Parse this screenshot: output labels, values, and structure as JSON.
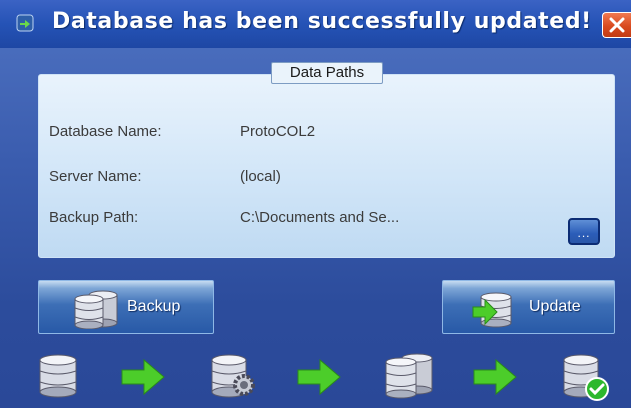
{
  "window": {
    "title": "Database has been successfully updated!"
  },
  "panel": {
    "title": "Data Paths",
    "fields": [
      {
        "label": "Database Name:",
        "value": "ProtoCOL2"
      },
      {
        "label": "Server Name:",
        "value": "(local)"
      },
      {
        "label": "Backup Path:",
        "value": "C:\\Documents and Se..."
      }
    ],
    "browse_label": "..."
  },
  "buttons": {
    "backup_label": "Backup",
    "update_label": "Update"
  },
  "workflow": {
    "steps": [
      "database-icon",
      "arrow-right-icon",
      "database-settings-icon",
      "arrow-right-icon",
      "database-stack-icon",
      "arrow-right-icon",
      "database-check-icon"
    ]
  },
  "colors": {
    "background": "#3a5cae",
    "titlebar": "#2553b6",
    "close": "#d94a1f",
    "arrow": "#4ccd2a",
    "check": "#2db82d"
  }
}
